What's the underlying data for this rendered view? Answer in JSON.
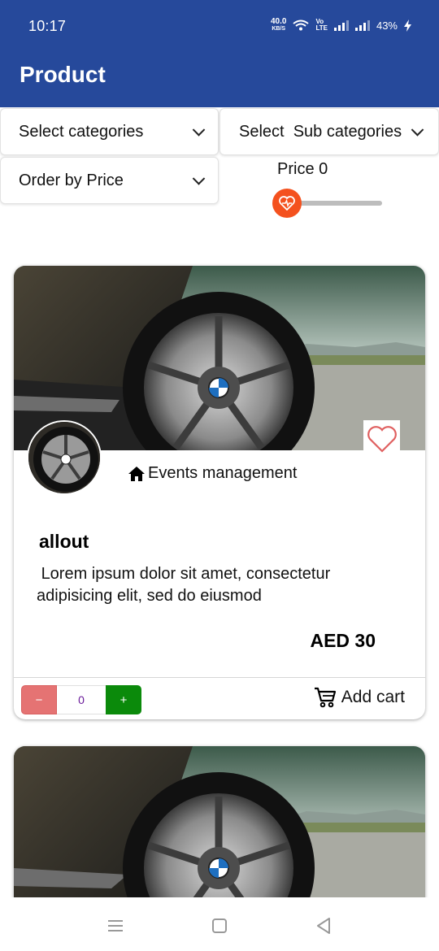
{
  "status_bar": {
    "time": "10:17",
    "net_speed": "40.0",
    "net_speed_unit": "KB/S",
    "volte": "VoLTE",
    "battery": "43%"
  },
  "app_bar": {
    "title": "Product"
  },
  "filters": {
    "category_label": "Select categories",
    "subcategory_label": "Select  Sub categories",
    "order_label": "Order by Price",
    "price_label": "Price 0",
    "price_value": 0
  },
  "products": [
    {
      "category": "Events management",
      "title": "allout",
      "description": " Lorem ipsum dolor sit amet, consectetur adipisicing elit, sed do eiusmod",
      "price": "AED 30",
      "quantity": "0",
      "minus_label": "−",
      "plus_label": "+",
      "add_cart_label": "Add cart"
    }
  ],
  "colors": {
    "app_bar": "#26499b",
    "slider_thumb": "#f4511e",
    "minus_button": "#e57373",
    "plus_button": "#0b8a0b",
    "favorite": "#e06060"
  }
}
